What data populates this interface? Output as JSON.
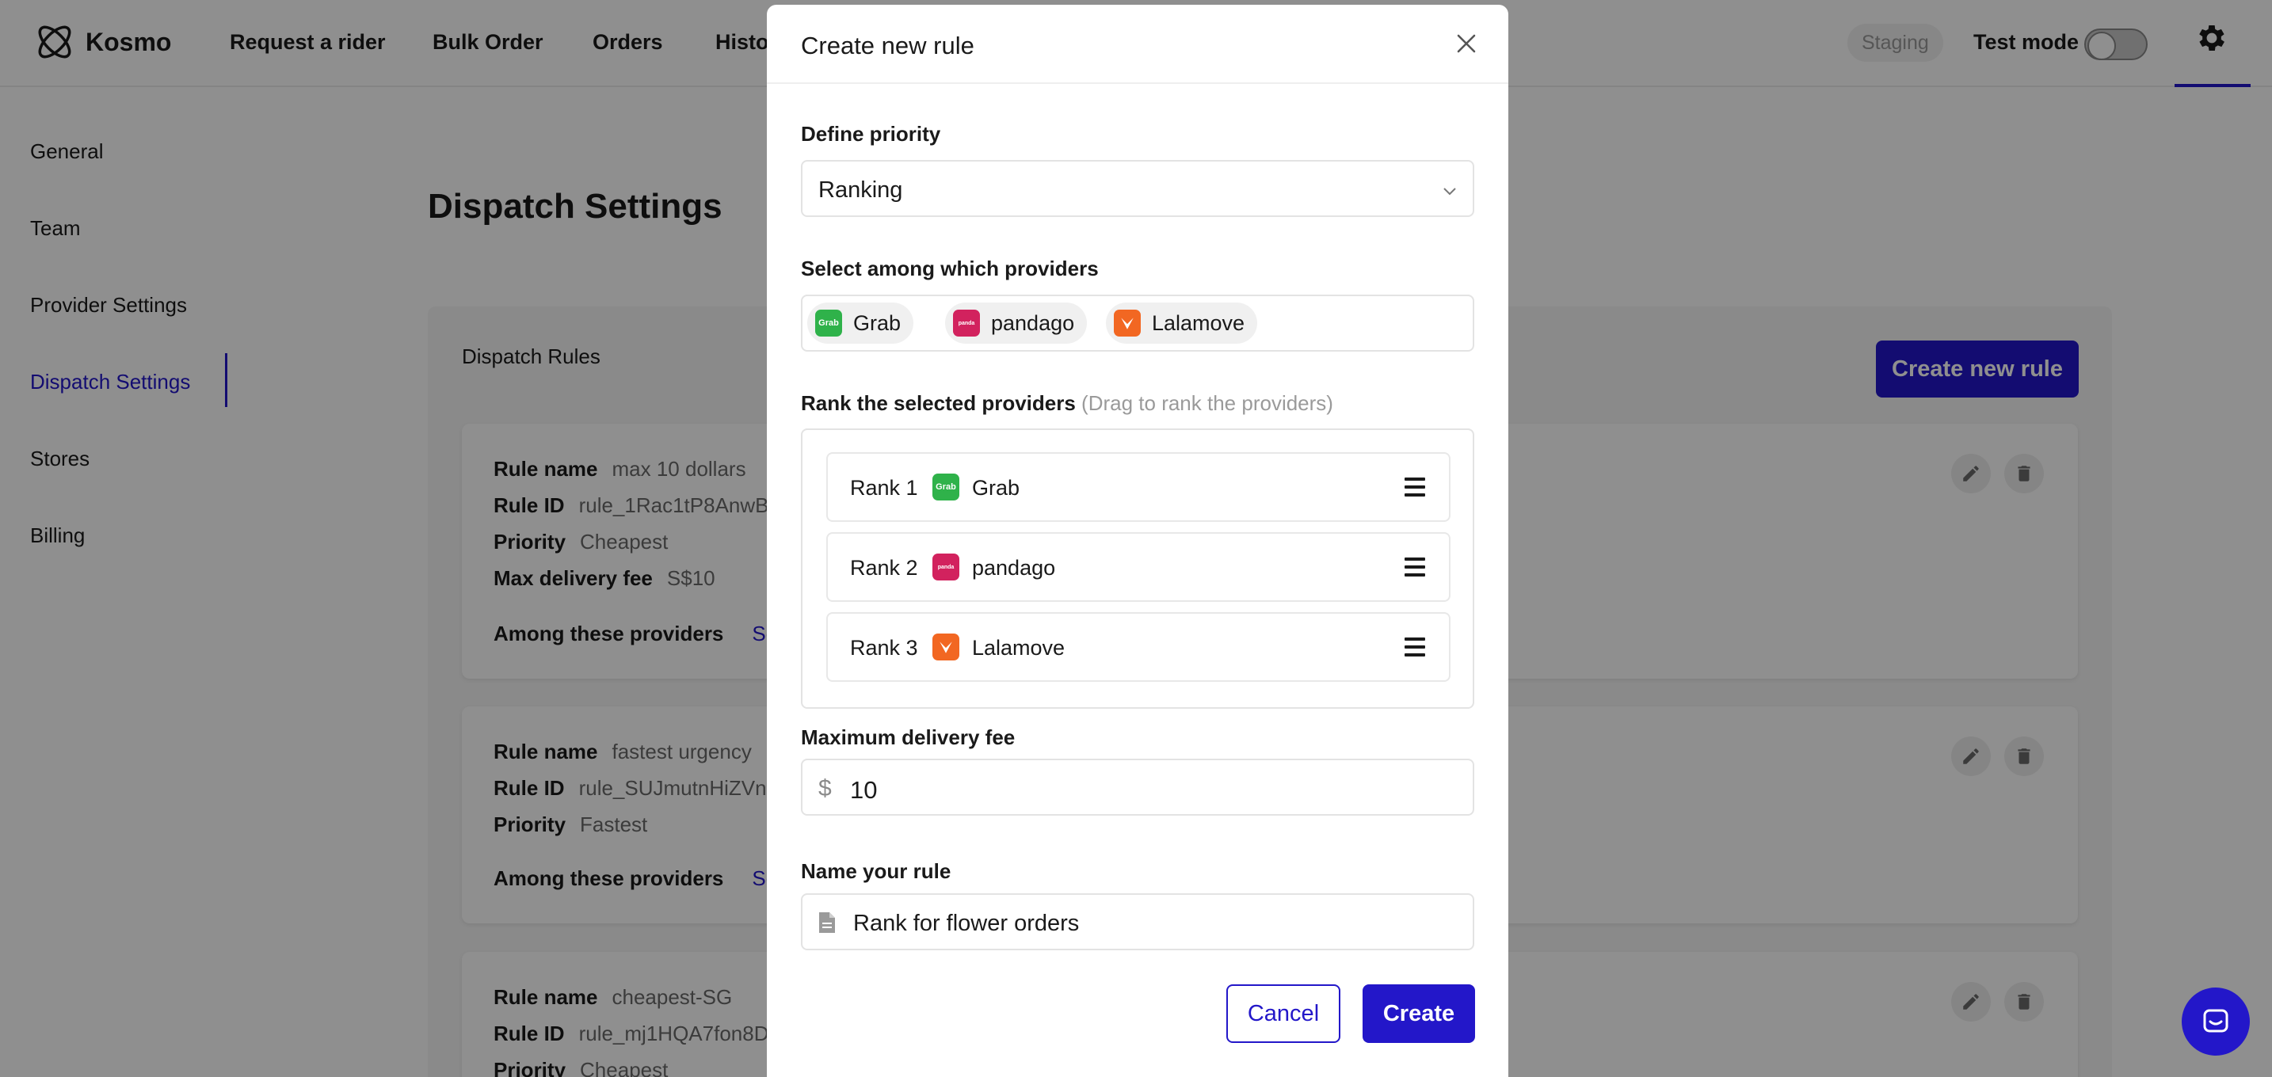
{
  "app": {
    "name": "Kosmo"
  },
  "nav": {
    "items": [
      "Request a rider",
      "Bulk Order",
      "Orders",
      "Histo"
    ],
    "staging": "Staging",
    "test_mode": "Test mode"
  },
  "sidebar": {
    "items": [
      "General",
      "Team",
      "Provider Settings",
      "Dispatch Settings",
      "Stores",
      "Billing"
    ],
    "active": "Dispatch Settings"
  },
  "main": {
    "title": "Dispatch Settings",
    "rules_heading": "Dispatch Rules",
    "create_button": "Create new rule",
    "labels": {
      "rule_name": "Rule name",
      "rule_id": "Rule ID",
      "priority": "Priority",
      "max_fee": "Max delivery fee",
      "among": "Among these providers",
      "see": "See"
    },
    "rules": [
      {
        "name": "max 10 dollars",
        "id": "rule_1Rac1tP8AnwB",
        "priority": "Cheapest",
        "max_fee": "S$10"
      },
      {
        "name": "fastest urgency",
        "id": "rule_SUJmutnHiZVn",
        "priority": "Fastest"
      },
      {
        "name": "cheapest-SG",
        "id": "rule_mj1HQA7fon8D",
        "priority": "Cheapest"
      }
    ]
  },
  "modal": {
    "title": "Create new rule",
    "priority_label": "Define priority",
    "priority_value": "Ranking",
    "providers_label": "Select among which providers",
    "providers": [
      {
        "name": "Grab",
        "logo": "grab-logo",
        "logo_text": "Grab"
      },
      {
        "name": "pandago",
        "logo": "pandago-logo",
        "logo_text": "panda"
      },
      {
        "name": "Lalamove",
        "logo": "lalamove-logo",
        "logo_text": ""
      }
    ],
    "rank_label": "Rank the selected providers",
    "rank_hint": "(Drag to rank the providers)",
    "ranks": [
      {
        "label": "Rank 1",
        "provider": "Grab"
      },
      {
        "label": "Rank 2",
        "provider": "pandago"
      },
      {
        "label": "Rank 3",
        "provider": "Lalamove"
      }
    ],
    "max_fee_label": "Maximum delivery fee",
    "max_fee_prefix": "$",
    "max_fee_value": "10",
    "name_label": "Name your rule",
    "name_value": "Rank for flower orders",
    "cancel": "Cancel",
    "create": "Create"
  },
  "colors": {
    "accent": "#2317c9",
    "grab": "#2fb24a",
    "pandago": "#d2225e",
    "lalamove": "#f26722"
  }
}
